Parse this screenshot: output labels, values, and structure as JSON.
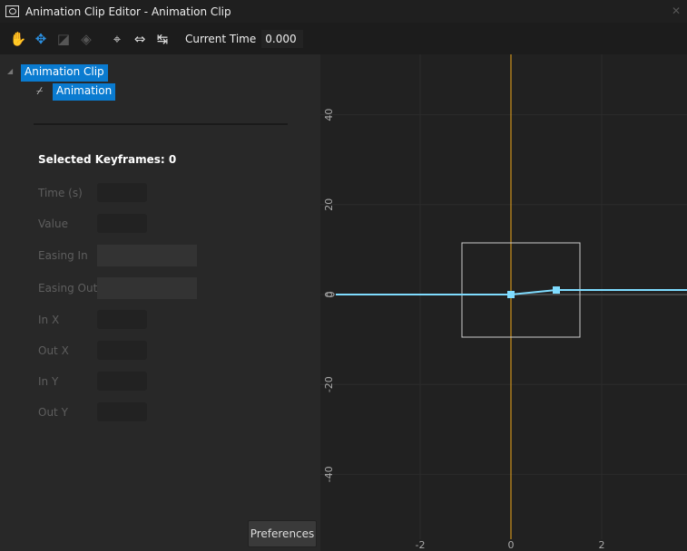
{
  "window": {
    "title": "Animation Clip Editor - Animation Clip",
    "close_icon": "close-icon"
  },
  "toolbar": {
    "tools": [
      "hand-icon",
      "move-icon",
      "scale-icon",
      "keyframe-icon",
      "center-view-icon",
      "fit-horizontal-icon",
      "fit-time-icon"
    ],
    "current_time_label": "Current Time",
    "current_time_value": "0.000"
  },
  "tree": {
    "root": "Animation Clip",
    "child": "Animation"
  },
  "properties": {
    "selected_label": "Selected Keyframes:",
    "selected_count": "0",
    "fields": [
      "Time (s)",
      "Value",
      "Easing In",
      "Easing Out",
      "In X",
      "Out X",
      "In Y",
      "Out Y"
    ]
  },
  "preferences_label": "Preferences",
  "colors": {
    "curve": "#7fdcff",
    "playhead": "#f0a81c",
    "selection": "#0a7bd0"
  },
  "chart_data": {
    "type": "line",
    "x_ticks": [
      "-2",
      "0",
      "2"
    ],
    "y_ticks": [
      "40",
      "20",
      "0",
      "-20",
      "-40"
    ],
    "keyframes": [
      {
        "x": 0,
        "y": 0
      },
      {
        "x": 1,
        "y": 1
      }
    ],
    "current_time": 0,
    "grid": true
  }
}
